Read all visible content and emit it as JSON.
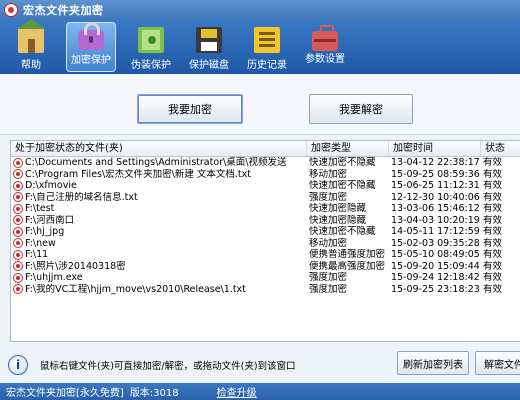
{
  "window": {
    "title": "宏杰文件夹加密"
  },
  "toolbar": {
    "items": [
      {
        "label": "帮助",
        "icon": "home-icon"
      },
      {
        "label": "加密保护",
        "icon": "lock-icon"
      },
      {
        "label": "伪装保护",
        "icon": "book-icon"
      },
      {
        "label": "保护磁盘",
        "icon": "disk-icon"
      },
      {
        "label": "历史记录",
        "icon": "log-icon"
      },
      {
        "label": "参数设置",
        "icon": "tools-icon"
      }
    ],
    "active": "加密保护"
  },
  "actions": {
    "encrypt": "我要加密",
    "decrypt": "我要解密"
  },
  "table": {
    "headers": [
      "处于加密状态的文件(夹)",
      "加密类型",
      "加密时间",
      "状态"
    ],
    "rows": [
      [
        "C:\\Documents and Settings\\Administrator\\桌面\\视频发送",
        "快速加密不隐藏",
        "13-04-12 22:38:17",
        "有效"
      ],
      [
        "C:\\Program Files\\宏杰文件夹加密\\新建 文本文档.txt",
        "移动加密",
        "15-09-25 08:59:36",
        "有效"
      ],
      [
        "D:\\xfmovie",
        "快速加密不隐藏",
        "15-06-25 11:12:31",
        "有效"
      ],
      [
        "F:\\自己注册的域名信息.txt",
        "强度加密",
        "12-12-30 10:40:06",
        "有效"
      ],
      [
        "F:\\test",
        "快速加密隐藏",
        "13-03-06 15:46:12",
        "有效"
      ],
      [
        "F:\\河西南口",
        "快速加密隐藏",
        "13-04-03 10:20:19",
        "有效"
      ],
      [
        "F:\\hj_jpg",
        "快速加密不隐藏",
        "14-05-11 17:12:59",
        "有效"
      ],
      [
        "F:\\new",
        "移动加密",
        "15-02-03 09:35:28",
        "有效"
      ],
      [
        "F:\\11",
        "便携普通强度加密",
        "15-05-10 08:49:05",
        "有效"
      ],
      [
        "F:\\照片\\涉20140318密",
        "便携最高强度加密",
        "15-09-20 15:09:44",
        "有效"
      ],
      [
        "F:\\uhjjm.exe",
        "强度加密",
        "15-09-24 12:18:42",
        "有效"
      ],
      [
        "F:\\我的VC工程\\hjjm_move\\vs2010\\Release\\1.txt",
        "强度加密",
        "15-09-25 23:18:23",
        "有效"
      ]
    ]
  },
  "info": {
    "text": "鼠标右键文件(夹)可直接加密/解密，或拖动文件(夹)到该窗口",
    "refresh": "刷新加密列表",
    "decrypt_file": "解密文件("
  },
  "statusbar": {
    "app": "宏杰文件夹加密[永久免费]",
    "version": "版本:3018",
    "update": "检查升级"
  },
  "colors": {
    "titlebar": "#4a84c4",
    "toolbar": "#2a66b2",
    "statusbar": "#3169b2",
    "lock_red": "#c0302a"
  }
}
